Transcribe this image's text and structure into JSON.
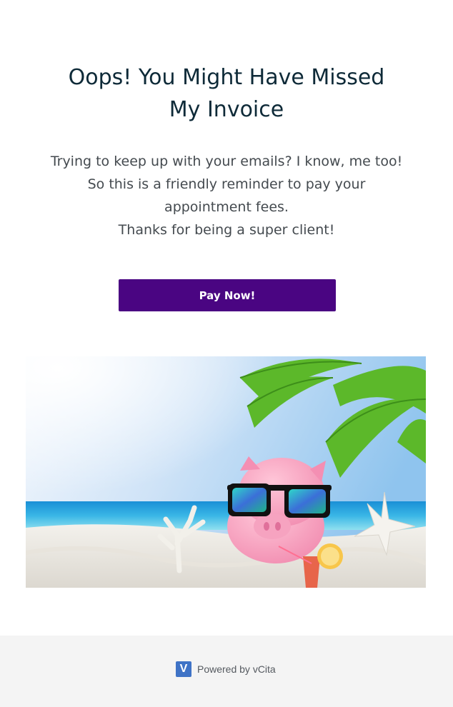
{
  "header": {
    "title_line1": "Oops! You Might Have Missed",
    "title_line2": "My Invoice"
  },
  "message": {
    "line1": "Trying to keep up with your emails? I know, me too!",
    "line2": "So this is a friendly reminder to pay your",
    "line3": "appointment fees.",
    "line4": "Thanks for being a super client!"
  },
  "cta": {
    "label": "Pay Now!",
    "color": "#4a0582"
  },
  "footer": {
    "powered_label": "Powered by vCita",
    "logo_letter": "V"
  }
}
